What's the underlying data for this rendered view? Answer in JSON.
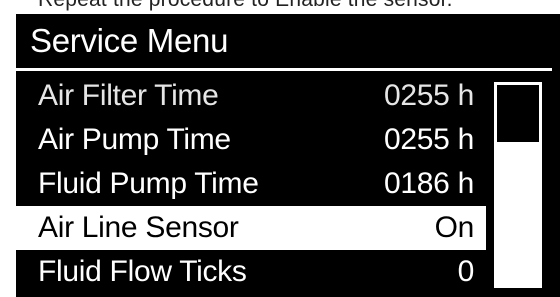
{
  "caption": "Repeat the procedure to Enable the sensor.",
  "service_menu": {
    "title": "Service Menu",
    "items": [
      {
        "label": "Air Filter Time",
        "value": "0255 h",
        "selected": false
      },
      {
        "label": "Air Pump Time",
        "value": "0255 h",
        "selected": false
      },
      {
        "label": "Fluid Pump Time",
        "value": "0186 h",
        "selected": false
      },
      {
        "label": "Air Line Sensor",
        "value": "On",
        "selected": true
      },
      {
        "label": "Fluid Flow Ticks",
        "value": "0",
        "selected": false
      }
    ],
    "scroll_position": 0
  },
  "colors": {
    "screen_background": "#000000",
    "text": "#ffffff",
    "selection_background": "#ffffff",
    "selection_text": "#000000"
  }
}
